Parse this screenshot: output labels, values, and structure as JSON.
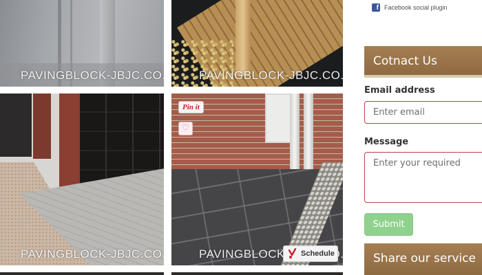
{
  "gallery": {
    "watermark": "PAVINGBLOCK-JBJC.CO.UK",
    "photos": [
      {
        "subject": "grey clad wall"
      },
      {
        "subject": "wooden deck"
      },
      {
        "subject": "block paved driveway"
      },
      {
        "subject": "slab patio"
      }
    ],
    "pinit_label": "Pin it",
    "heart_icon": "heart-icon",
    "schedule_label": "Schedule",
    "schedule_icon": "schedule-icon"
  },
  "sidebar": {
    "facebook_plugin": "Facebook social plugin",
    "contact": {
      "heading": "Cotnact Us",
      "email_label": "Email address",
      "email_placeholder": "Enter email",
      "message_label": "Message",
      "message_placeholder": "Enter your required",
      "submit_label": "Submit"
    },
    "share_heading": "Share our service"
  },
  "colors": {
    "section_header": "#9a7449",
    "submit_button": "#8fd18d",
    "field_border": "#b9404a",
    "facebook_blue": "#3b5998"
  }
}
